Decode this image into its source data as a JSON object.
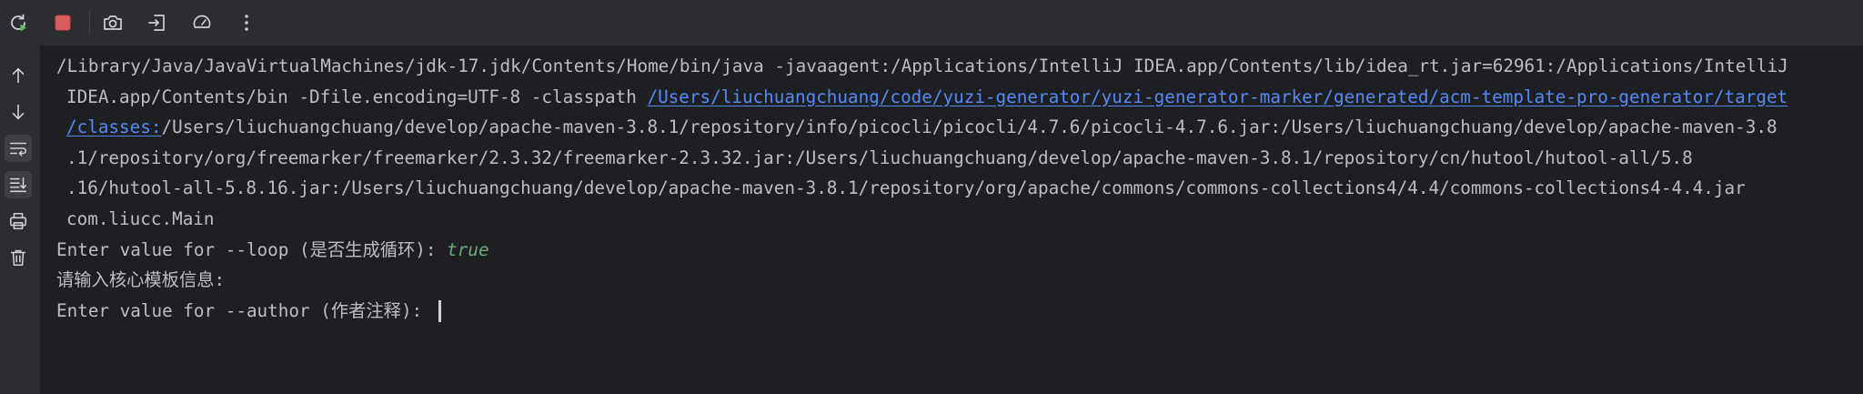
{
  "toolbar": {
    "buttons": [
      {
        "name": "rerun",
        "icon": "rerun-icon",
        "color": "#5fb865"
      },
      {
        "name": "stop",
        "icon": "stop-icon",
        "color": "#db5c5c"
      },
      {
        "name": "screenshot",
        "icon": "camera-icon"
      },
      {
        "name": "exit",
        "icon": "exit-icon"
      },
      {
        "name": "profiler",
        "icon": "speedometer-icon"
      },
      {
        "name": "more",
        "icon": "more-vertical-icon"
      }
    ]
  },
  "sidebar": {
    "buttons": [
      {
        "name": "up",
        "icon": "arrow-up-icon"
      },
      {
        "name": "down",
        "icon": "arrow-down-icon"
      },
      {
        "name": "soft-wrap",
        "icon": "soft-wrap-icon",
        "active": true
      },
      {
        "name": "scroll-to-end",
        "icon": "scroll-to-end-icon",
        "active": true
      },
      {
        "name": "print",
        "icon": "printer-icon"
      },
      {
        "name": "clear",
        "icon": "trash-icon"
      }
    ]
  },
  "console": {
    "cmd": {
      "l1": "/Library/Java/JavaVirtualMachines/jdk-17.jdk/Contents/Home/bin/java -javaagent:/Applications/IntelliJ IDEA.app/Contents/lib/idea_rt.jar=62961:/Applications/IntelliJ",
      "l2_text": "IDEA.app/Contents/bin -Dfile.encoding=UTF-8 -classpath ",
      "l2_link": "/Users/liuchuangchuang/code/yuzi-generator/yuzi-generator-marker/generated/acm-template-pro-generator/target",
      "l3_link": "/classes:",
      "l3_text": "/Users/liuchuangchuang/develop/apache-maven-3.8.1/repository/info/picocli/picocli/4.7.6/picocli-4.7.6.jar:/Users/liuchuangchuang/develop/apache-maven-3.8",
      "l4": ".1/repository/org/freemarker/freemarker/2.3.32/freemarker-2.3.32.jar:/Users/liuchuangchuang/develop/apache-maven-3.8.1/repository/cn/hutool/hutool-all/5.8",
      "l5": ".16/hutool-all-5.8.16.jar:/Users/liuchuangchuang/develop/apache-maven-3.8.1/repository/org/apache/commons/commons-collections4/4.4/commons-collections4-4.4.jar",
      "l6": "com.liucc.Main"
    },
    "prompt_loop": "Enter value for --loop (是否生成循环): ",
    "prompt_loop_value": "true",
    "info_line": "请输入核心模板信息:",
    "prompt_author": "Enter value for --author (作者注释): "
  },
  "colors": {
    "background": "#1e1f22",
    "toolbar": "#2b2d30",
    "text": "#bcbec4",
    "link": "#548af7",
    "user_input": "#6aab73"
  }
}
